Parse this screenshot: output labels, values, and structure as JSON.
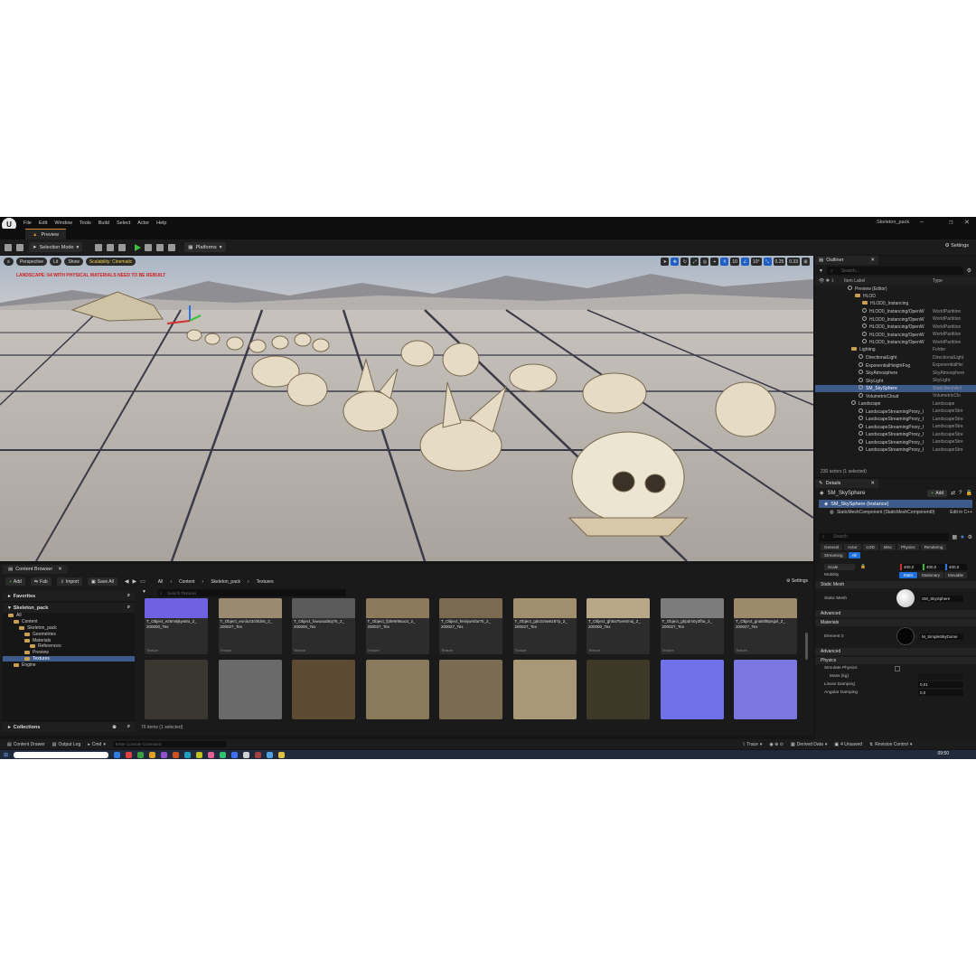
{
  "app": {
    "project_name": "Skeleton_pack",
    "menu": [
      "File",
      "Edit",
      "Window",
      "Tools",
      "Build",
      "Select",
      "Actor",
      "Help"
    ],
    "tab": "Preview"
  },
  "toolbar": {
    "selection_mode": "Selection Mode",
    "platforms": "Platforms",
    "settings": "Settings"
  },
  "viewport": {
    "perspective": "Perspective",
    "lit": "Lit",
    "show": "Show",
    "scalability": "Scalability: Cinematic",
    "warning": "LANDSCAPE: 64  WITH PHYSICAL MATERIALS NEED TO BE REBUILT",
    "grid_snap": "10",
    "rot_snap": "10°",
    "scale_snap": "0.25",
    "camera_speed": "0.33"
  },
  "outliner": {
    "tab": "Outliner",
    "search_placeholder": "Search...",
    "col_label": "Item Label",
    "col_type": "Type",
    "rows": [
      {
        "label": "Preview (Editor)",
        "type": "",
        "indent": 36,
        "kind": "obj"
      },
      {
        "label": "HLOD",
        "type": "",
        "indent": 44,
        "kind": "folder"
      },
      {
        "label": "HLOD0_Instancing",
        "type": "",
        "indent": 52,
        "kind": "folder"
      },
      {
        "label": "HLOD0_Instancing/OpenW",
        "type": "WorldPartition",
        "indent": 52,
        "kind": "obj"
      },
      {
        "label": "HLOD0_Instancing/OpenW",
        "type": "WorldPartition",
        "indent": 52,
        "kind": "obj"
      },
      {
        "label": "HLOD0_Instancing/OpenW",
        "type": "WorldPartition",
        "indent": 52,
        "kind": "obj"
      },
      {
        "label": "HLOD0_Instancing/OpenW",
        "type": "WorldPartition",
        "indent": 52,
        "kind": "obj"
      },
      {
        "label": "HLOD0_Instancing/OpenW",
        "type": "WorldPartition",
        "indent": 52,
        "kind": "obj"
      },
      {
        "label": "Lighting",
        "type": "Folder",
        "indent": 40,
        "kind": "folder"
      },
      {
        "label": "DirectionalLight",
        "type": "DirectionalLight",
        "indent": 48,
        "kind": "obj"
      },
      {
        "label": "ExponentialHeightFog",
        "type": "ExponentialHei",
        "indent": 48,
        "kind": "obj"
      },
      {
        "label": "SkyAtmosphere",
        "type": "SkyAtmosphere",
        "indent": 48,
        "kind": "obj"
      },
      {
        "label": "SkyLight",
        "type": "SkyLight",
        "indent": 48,
        "kind": "obj"
      },
      {
        "label": "SM_SkySphere",
        "type": "StaticMeshAct",
        "indent": 48,
        "kind": "obj",
        "selected": true
      },
      {
        "label": "VolumetricCloud",
        "type": "VolumetricClo",
        "indent": 48,
        "kind": "obj"
      },
      {
        "label": "Landscape",
        "type": "Landscape",
        "indent": 40,
        "kind": "obj"
      },
      {
        "label": "LandscapeStreamingProxy_I",
        "type": "LandscapeStre",
        "indent": 48,
        "kind": "obj"
      },
      {
        "label": "LandscapeStreamingProxy_I",
        "type": "LandscapeStre",
        "indent": 48,
        "kind": "obj"
      },
      {
        "label": "LandscapeStreamingProxy_I",
        "type": "LandscapeStre",
        "indent": 48,
        "kind": "obj"
      },
      {
        "label": "LandscapeStreamingProxy_I",
        "type": "LandscapeStre",
        "indent": 48,
        "kind": "obj"
      },
      {
        "label": "LandscapeStreamingProxy_I",
        "type": "LandscapeStre",
        "indent": 48,
        "kind": "obj"
      },
      {
        "label": "LandscapeStreamingProxy_I",
        "type": "LandscapeStre",
        "indent": 48,
        "kind": "obj"
      }
    ],
    "footer": "230 actors (1 selected)"
  },
  "details": {
    "tab": "Details",
    "actor": "SM_SkySphere",
    "add": "Add",
    "instance": "SM_SkySphere (Instance)",
    "component": "StaticMeshComponent (StaticMeshComponent0)",
    "edit_in": "Edit in C++",
    "search_placeholder": "Search",
    "filters": [
      {
        "label": "General",
        "on": false
      },
      {
        "label": "Actor",
        "on": false
      },
      {
        "label": "LOD",
        "on": false
      },
      {
        "label": "Misc",
        "on": false
      },
      {
        "label": "Physics",
        "on": false
      },
      {
        "label": "Rendering",
        "on": false
      },
      {
        "label": "Streaming",
        "on": false
      },
      {
        "label": "All",
        "on": true
      }
    ],
    "scale_label": "Scale",
    "scale": [
      "400,0",
      "400,0",
      "400,0"
    ],
    "mobility_label": "Mobility",
    "mobility": [
      "Static",
      "Stationary",
      "Movable"
    ],
    "sec_static_mesh": "Static Mesh",
    "static_mesh_label": "Static Mesh",
    "static_mesh_value": "SM_SkySphere",
    "sec_advanced": "Advanced",
    "sec_materials": "Materials",
    "element_label": "Element 0",
    "element_value": "M_SimpleSkyDome",
    "sec_advanced2": "Advanced",
    "sec_physics": "Physics",
    "simulate_physics": "Simulate Physics",
    "mass_kg": "Mass (kg)",
    "linear_damping_label": "Linear Damping",
    "linear_damping": "0,01",
    "angular_damping_label": "Angular Damping",
    "angular_damping": "0,0"
  },
  "content_browser": {
    "tab": "Content Browser",
    "add": "Add",
    "fab": "Fab",
    "import": "Import",
    "save_all": "Save All",
    "breadcrumb": [
      "All",
      "Content",
      "Skeleton_pack",
      "Textures"
    ],
    "settings": "Settings",
    "favorites": "Favorites",
    "root": "Skeleton_pack",
    "tree": [
      {
        "label": "All",
        "indent": 6
      },
      {
        "label": "Content",
        "indent": 12
      },
      {
        "label": "Skeleton_pack",
        "indent": 18
      },
      {
        "label": "Geometries",
        "indent": 24
      },
      {
        "label": "Materials",
        "indent": 24
      },
      {
        "label": "References",
        "indent": 30
      },
      {
        "label": "Preview",
        "indent": 24
      },
      {
        "label": "Textures",
        "indent": 24,
        "selected": true
      },
      {
        "label": "Engine",
        "indent": 12
      }
    ],
    "collections": "Collections",
    "search_placeholder": "Search Textures",
    "assets_row1": [
      {
        "name": "T_Object_e26m9jkyw8o_2_\n200000_Tex",
        "type": "Texture",
        "color": "#6f62e0"
      },
      {
        "name": "T_Object_eonlu43chfdn6_2_\n200027_Tex",
        "type": "Texture",
        "color": "#9a8a70"
      },
      {
        "name": "T_Object_fowoaxd8oj76_2_\n200000_Tex",
        "type": "Texture",
        "color": "#5a5a5a"
      },
      {
        "name": "T_Object_fj3le9r96oo3_2_\n200027_Tex",
        "type": "Texture",
        "color": "#8d7a5c"
      },
      {
        "name": "T_Object_femijwmfar75_2_\n200027_Tex",
        "type": "Texture",
        "color": "#7a6a52"
      },
      {
        "name": "T_Object_gdv2c9w6z87p_2_\n200027_Tex",
        "type": "Texture",
        "color": "#a08e6c"
      },
      {
        "name": "T_Object_gh0a75ve0moj_2_\n200000_Tex",
        "type": "Texture",
        "color": "#b8a888"
      },
      {
        "name": "T_Object_ghpdm0y2fha_2_\n200027_Tex",
        "type": "Texture",
        "color": "#7c7c7c"
      },
      {
        "name": "T_Object_gnati0l8pngxl_2_\n200027_Tex",
        "type": "Texture",
        "color": "#9c8a6a"
      }
    ],
    "assets_row2_colors": [
      "#3a3630",
      "#6a6a6a",
      "#5c4a32",
      "#8a7a5c",
      "#7a6c52",
      "#a89878",
      "#3e3828",
      "#7070e8",
      "#7a78e0"
    ],
    "count": "76 items (1 selected)"
  },
  "statusbar": {
    "content_drawer": "Content Drawer",
    "output_log": "Output Log",
    "cmd": "Cmd",
    "console_placeholder": "Enter Console Command",
    "trace": "Trace",
    "derived_data": "Derived Data",
    "unsaved": "4 Unsaved",
    "revision_control": "Revision Control"
  },
  "taskbar": {
    "clock": "09:50",
    "icon_colors": [
      "#2f7de0",
      "#e04040",
      "#3aa040",
      "#e0a020",
      "#9050d0",
      "#d05020",
      "#20a0c0",
      "#c0c020",
      "#e06090",
      "#30c070",
      "#4070f0",
      "#d0d0d0",
      "#a04040",
      "#50a0e0",
      "#e0c040"
    ]
  }
}
